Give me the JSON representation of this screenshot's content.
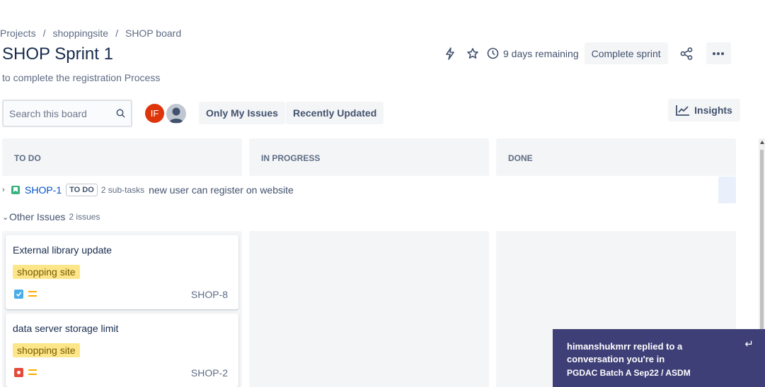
{
  "breadcrumb": [
    "Projects",
    "shoppingsite",
    "SHOP board"
  ],
  "sprint": {
    "title": "SHOP Sprint 1",
    "goal": "to complete the registration Process",
    "days_remaining": "9 days remaining",
    "complete_label": "Complete sprint"
  },
  "toolbar": {
    "search_placeholder": "Search this board",
    "avatar_initials": "IF",
    "filter_my_issues": "Only My Issues",
    "filter_recent": "Recently Updated",
    "insights_label": "Insights"
  },
  "columns": [
    "TO DO",
    "IN PROGRESS",
    "DONE"
  ],
  "swimlane": {
    "key": "SHOP-1",
    "status": "TO DO",
    "subtasks": "2 sub-tasks",
    "summary": "new user can register on website"
  },
  "other_issues": {
    "label": "Other Issues",
    "count": "2 issues"
  },
  "cards": [
    {
      "title": "External library update",
      "label": "shopping site",
      "type": "task-icon",
      "priority": "medium-priority-icon",
      "key": "SHOP-8"
    },
    {
      "title": "data server storage limit",
      "label": "shopping site",
      "type": "bug-icon",
      "priority": "medium-priority-icon",
      "key": "SHOP-2"
    }
  ],
  "notification": {
    "title": "himanshukmrr replied to a conversation you're in",
    "subtitle": "PGDAC Batch A Sep22 / ASDM"
  },
  "colors": {
    "label_bg": "#fde68a",
    "story": "#36b37e",
    "task": "#4bade8",
    "bug": "#e5493a",
    "priority_medium": "#ffab00",
    "link": "#0052cc",
    "notification_bg": "#3f3f78"
  }
}
